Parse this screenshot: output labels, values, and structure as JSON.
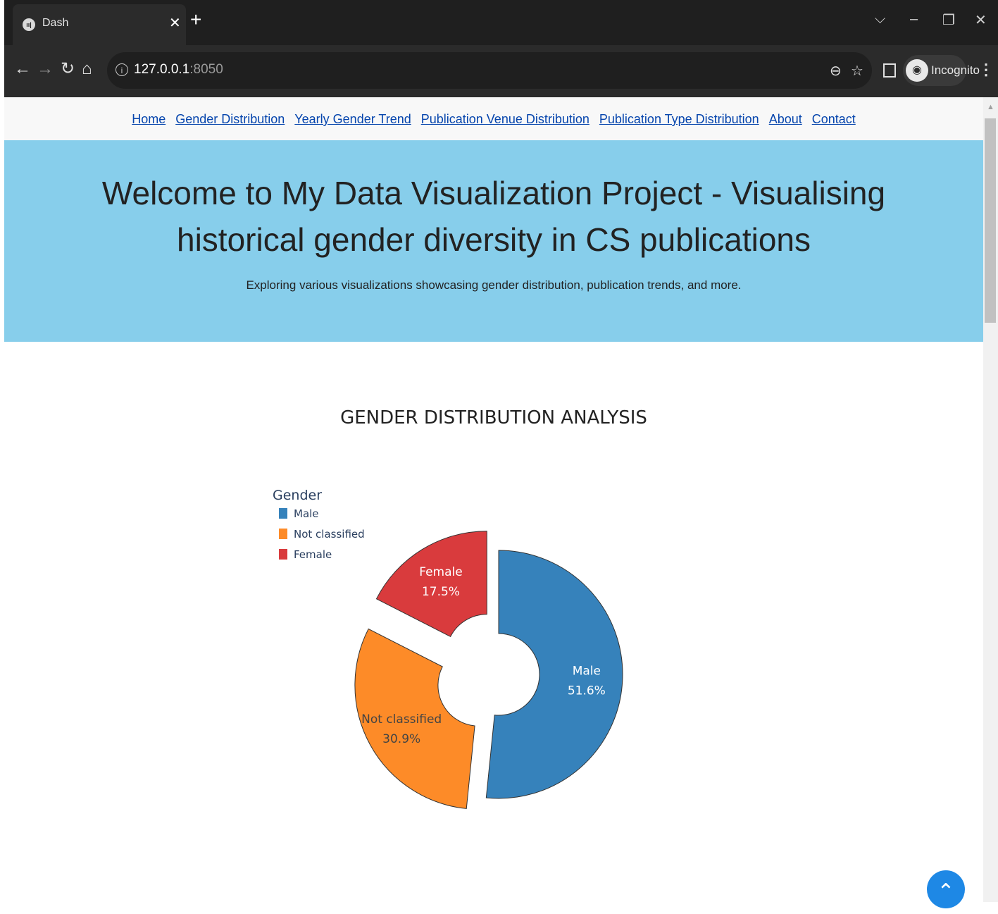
{
  "browser": {
    "tab_title": "Dash",
    "favicon_text": "ıı|",
    "url_host": "127.0.0.1",
    "url_port": ":8050",
    "incognito_label": "Incognito"
  },
  "nav": {
    "links": [
      "Home",
      "Gender Distribution",
      "Yearly Gender Trend",
      "Publication Venue Distribution",
      "Publication Type Distribution",
      "About",
      "Contact"
    ]
  },
  "hero": {
    "title": "Welcome to My Data Visualization Project - Visualising historical gender diversity in CS publications",
    "subtitle": "Exploring various visualizations showcasing gender distribution, publication trends, and more."
  },
  "colors": {
    "nav_link": "#0645ad",
    "hero_bg": "#87ceeb",
    "male": "#3682bb",
    "not_classified": "#fd8b28",
    "female": "#d93b3d"
  },
  "chart_data": {
    "type": "pie",
    "title": "GENDER DISTRIBUTION ANALYSIS",
    "legend_title": "Gender",
    "legend_position": "top-left",
    "hole": true,
    "slices": [
      {
        "label": "Male",
        "value": 51.6,
        "text": "51.6%",
        "color": "#3682bb",
        "pulled": false
      },
      {
        "label": "Not classified",
        "value": 30.9,
        "text": "30.9%",
        "color": "#fd8b28",
        "pulled": true
      },
      {
        "label": "Female",
        "value": 17.5,
        "text": "17.5%",
        "color": "#d93b3d",
        "pulled": true
      }
    ]
  }
}
